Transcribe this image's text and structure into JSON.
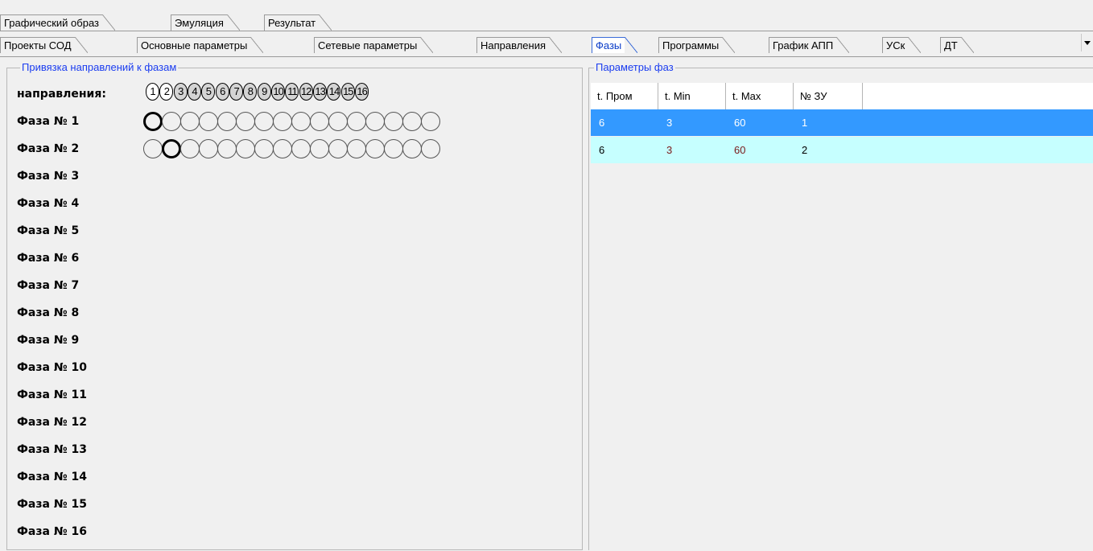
{
  "tabs_top": [
    "Графический образ",
    "Эмуляция",
    "Результат"
  ],
  "tabs_main": [
    "Проекты СОД",
    "Основные параметры",
    "Сетевые параметры",
    "Направления",
    "Фазы",
    "Программы",
    "График АПП",
    "УСк",
    "ДТ"
  ],
  "active_tab": "Фазы",
  "left_panel": {
    "caption": "Привязка направлений к фазам",
    "directions_label": "направления:",
    "direction_numbers": [
      "1",
      "2",
      "3",
      "4",
      "5",
      "6",
      "7",
      "8",
      "9",
      "10",
      "11",
      "12",
      "13",
      "14",
      "15",
      "16"
    ],
    "phases": [
      "Фаза № 1",
      "Фаза № 2",
      "Фаза № 3",
      "Фаза № 4",
      "Фаза № 5",
      "Фаза № 6",
      "Фаза № 7",
      "Фаза № 8",
      "Фаза № 9",
      "Фаза № 10",
      "Фаза № 11",
      "Фаза № 12",
      "Фаза № 13",
      "Фаза № 14",
      "Фаза № 15",
      "Фаза № 16"
    ],
    "selection_rows": [
      {
        "phase": 1,
        "selected_direction": 1
      },
      {
        "phase": 2,
        "selected_direction": 2
      }
    ]
  },
  "right_panel": {
    "caption": "Параметры фаз",
    "columns": [
      "t. Пром",
      "t. Min",
      "t. Max",
      "№ ЗУ"
    ],
    "rows": [
      [
        "6",
        "3",
        "60",
        "1"
      ],
      [
        "6",
        "3",
        "60",
        "2"
      ]
    ]
  },
  "colors": {
    "selected_row": "#3399ff",
    "alt_row": "#c6ffff",
    "caption": "#1a3cf0",
    "active_tab_text": "#0a3cc8"
  }
}
